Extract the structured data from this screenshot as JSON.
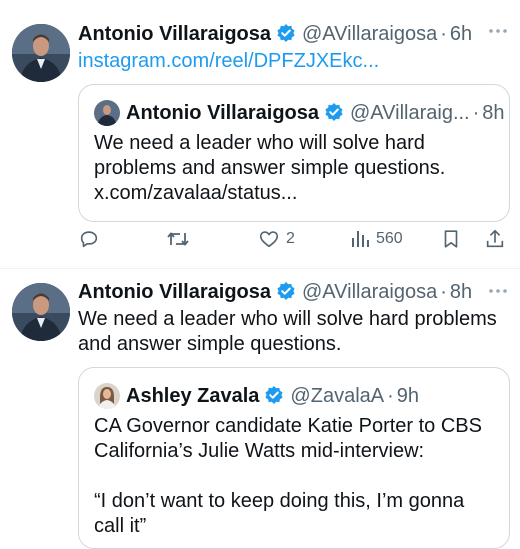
{
  "tweet1": {
    "author_name": "Antonio Villaraigosa",
    "handle": "@AVillaraigosa",
    "separator": "·",
    "time": "6h",
    "link": "instagram.com/reel/DPFZJXEkc...",
    "quote": {
      "author_name": "Antonio Villaraigosa",
      "handle": "@AVillaraig...",
      "separator": "·",
      "time": "8h",
      "text_line1": "We need a leader who will solve hard",
      "text_line2": "problems and answer simple questions.",
      "text_line3": "x.com/zavalaa/status..."
    },
    "actions": {
      "reply_count": "",
      "retweet_count": "",
      "like_count": "2",
      "views_count": "560"
    }
  },
  "tweet2": {
    "author_name": "Antonio Villaraigosa",
    "handle": "@AVillaraigosa",
    "separator": "·",
    "time": "8h",
    "text_line1": "We need a leader who will solve hard problems",
    "text_line2": "and answer simple questions.",
    "quote": {
      "author_name": "Ashley Zavala",
      "handle": "@ZavalaA",
      "separator": "·",
      "time": "9h",
      "text_line1": "CA Governor candidate Katie Porter to CBS",
      "text_line2": "California’s Julie Watts mid-interview:",
      "text_line3": "“I don’t want to keep doing this, I’m gonna",
      "text_line4": "call it”"
    }
  },
  "colors": {
    "verified": "#1d9bf0",
    "link": "#1d9bf0",
    "muted": "#536471",
    "border": "#cfd9de"
  },
  "icons": {
    "more": "more-icon",
    "verified": "verified-badge-icon",
    "reply": "reply-icon",
    "retweet": "retweet-icon",
    "like": "like-icon",
    "views": "views-icon",
    "bookmark": "bookmark-icon",
    "share": "share-icon"
  }
}
